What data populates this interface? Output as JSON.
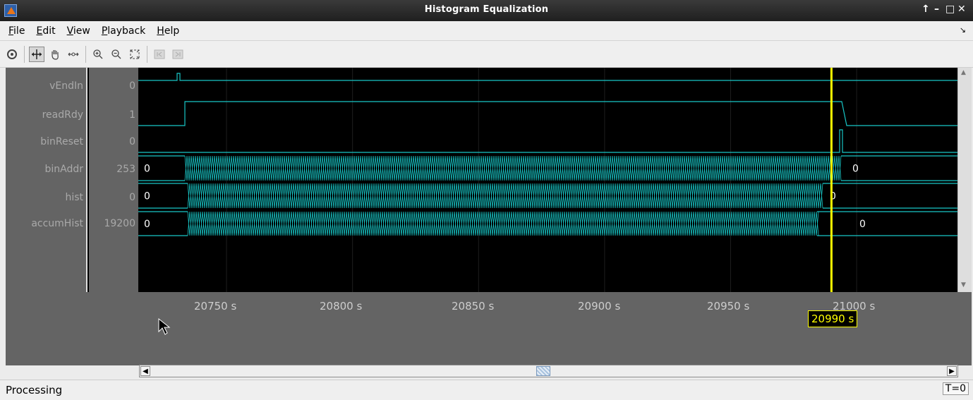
{
  "window": {
    "title": "Histogram Equalization",
    "controls": [
      "↑",
      "–",
      "□",
      "✕"
    ]
  },
  "menu": {
    "items": [
      {
        "acc": "F",
        "rest": "ile"
      },
      {
        "acc": "E",
        "rest": "dit"
      },
      {
        "acc": "V",
        "rest": "iew"
      },
      {
        "acc": "P",
        "rest": "layback"
      },
      {
        "acc": "H",
        "rest": "elp"
      }
    ],
    "dock_arrow": "↘"
  },
  "toolbar": {
    "icons": [
      "settings-icon",
      "zoom-cursor-icon",
      "pan-hand-icon",
      "zoom-x-icon",
      "zoom-in-icon",
      "zoom-out-icon",
      "fit-to-view-icon",
      "prev-edge-icon",
      "next-edge-icon"
    ]
  },
  "signals": [
    {
      "name": "vEndIn",
      "value": "0",
      "kind": "bit"
    },
    {
      "name": "readRdy",
      "value": "1",
      "kind": "bit"
    },
    {
      "name": "binReset",
      "value": "0",
      "kind": "bit"
    },
    {
      "name": "binAddr",
      "value": "253",
      "kind": "bus",
      "start_label": "0",
      "end_label": "0"
    },
    {
      "name": "hist",
      "value": "0",
      "kind": "bus",
      "start_label": "0",
      "end_label": "0"
    },
    {
      "name": "accumHist",
      "value": "19200",
      "kind": "bus",
      "start_label": "0",
      "end_label": "0"
    }
  ],
  "axis": {
    "ticks": [
      "20750 s",
      "20800 s",
      "20850 s",
      "20900 s",
      "20950 s",
      "21000 s"
    ],
    "range_start": 20715,
    "range_end": 21040,
    "cursor_time": 20990,
    "cursor_label": "20990 s"
  },
  "colors": {
    "trace": "#18c6c6",
    "cursor": "#ffff00",
    "background": "#000000",
    "label_panel": "#646464"
  },
  "status": {
    "text": "Processing",
    "time_readout": "T=0"
  }
}
